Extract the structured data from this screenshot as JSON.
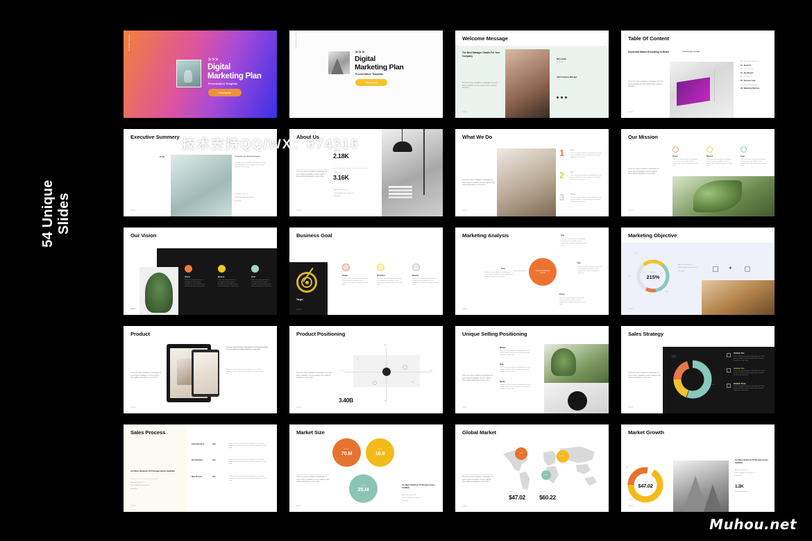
{
  "page": {
    "background": "#000000",
    "side_label": "54 Unique\nSlides",
    "watermark_center": "技术支持QQ/WX：674316",
    "watermark_corner": "Muhou.net"
  },
  "common": {
    "lede": "Good Idea Makes\nEverything Is\nBetter",
    "paragraph": "There are many variations of passages of Lorem Ipsum available, but the majority have suffered alteration in some form.",
    "page_number": "2049",
    "bullets_heading": "Are Many Variations Of Passages Ipsum Available.",
    "bullets": [
      "Approach Format  -  01",
      "Simon Slightly Reasonable 17",
      "Everyright"
    ]
  },
  "slides": [
    {
      "id": "s1",
      "title": "",
      "kind": "hero-gradient",
      "side_text": "Presentation Template",
      "chevron": ">>>",
      "heading_line1": "Digital",
      "heading_line2": "Marketing Plan",
      "subtitle": "Presentation Template",
      "button": "Powerpoint",
      "colors": {
        "gradient_from": "#f0813a",
        "gradient_mid": "#a94bd6",
        "gradient_to": "#3b30e8",
        "button": "#f0913c"
      }
    },
    {
      "id": "s2",
      "title": "",
      "kind": "hero-white",
      "side_text": "Marketing Agency Slide",
      "chevron": ">>>",
      "heading_line1": "Digital",
      "heading_line2": "Marketing Plan",
      "subtitle": "Presentation Template",
      "button": "Powerpoint",
      "colors": {
        "button": "#f6c32a"
      }
    },
    {
      "id": "s3",
      "title": "Welcome Message",
      "kind": "welcome",
      "bg": "#eaf3ed",
      "lede": "The Best Manager Details For Your Company",
      "paragraph": "There are many variations of passages of Lorem Ipsum available, but the majority have suffered alteration.",
      "person_name": "Mary Smith",
      "person_role": "Marketing",
      "person_company": "CEO Company Manager",
      "social": [
        "f",
        "t",
        "in"
      ],
      "page_number": "2049"
    },
    {
      "id": "s4",
      "title": "Table Of Content",
      "kind": "toc",
      "lede": "Good Idea Makes\nEverything Is\nBetter",
      "paragraph": "There are many variations of passages of Lorem Ipsum available but the majority have suffered alteration.",
      "content_label": "Content Details Size Slide",
      "items": [
        {
          "num": "01",
          "label": "Executive Summery",
          "bold": false
        },
        {
          "num": "02",
          "label": "About Us",
          "bold": true
        },
        {
          "num": "03",
          "label": "What We Do",
          "bold": false
        },
        {
          "num": "04",
          "label": "Our Mission",
          "bold": true
        },
        {
          "num": "05",
          "label": "Our Vision",
          "bold": false
        },
        {
          "num": "06",
          "label": "Business Goal",
          "bold": true
        },
        {
          "num": "07",
          "label": "Marketing Analysis",
          "bold": false
        },
        {
          "num": "08",
          "label": "Marketing Objective",
          "bold": true
        }
      ],
      "page_number": "2049"
    },
    {
      "id": "s5",
      "title": "Executive Summery",
      "kind": "exec",
      "plan_label": "PLAN",
      "right_heading": "Getting Plan The Real Time Generator",
      "list": [
        "Executive Format - 01",
        "Simply Slightly Reasonable 17",
        "Everyright"
      ],
      "page_number": "2049"
    },
    {
      "id": "s6",
      "title": "About Us",
      "kind": "about",
      "stat1_label": "Quantity",
      "stat1_value": "2.18K",
      "stat2_label": "Total",
      "stat2_value": "3.16K",
      "list": [
        "Approach Format - 01",
        "Simon Slightly Reasonable 17",
        "Everyright"
      ],
      "page_number": "2049"
    },
    {
      "id": "s7",
      "title": "What We Do",
      "kind": "whatwedo",
      "steps": [
        {
          "num": "1",
          "label": "One",
          "color": "#e8764a"
        },
        {
          "num": "2",
          "label": "Two",
          "color": "#d5d94a"
        },
        {
          "num": "3",
          "label": "Three",
          "color": "#cfcfcf"
        }
      ],
      "page_number": "2049"
    },
    {
      "id": "s8",
      "title": "Our Mission",
      "kind": "mission",
      "cards": [
        {
          "label": "Vision",
          "color": "#e8764a"
        },
        {
          "label": "Mission",
          "color": "#f2c230"
        },
        {
          "label": "Goal",
          "color": "#89c9bd"
        }
      ],
      "page_number": "2049"
    },
    {
      "id": "s9",
      "title": "Our Vision",
      "kind": "vision",
      "cards": [
        {
          "label": "Vision",
          "color": "#ee7a3c"
        },
        {
          "label": "Mission",
          "color": "#f3cb1b"
        },
        {
          "label": "Goal",
          "color": "#9fd9cd"
        }
      ],
      "page_number": "2049"
    },
    {
      "id": "s10",
      "title": "Business Goal",
      "kind": "bizgoal",
      "target_label": "Target",
      "cards": [
        {
          "label": "Target",
          "color": "#e8a38c"
        },
        {
          "label": "Business",
          "color": "#f3e06a"
        },
        {
          "label": "Special",
          "color": "#c8c8c8"
        }
      ],
      "page_number": "2049"
    },
    {
      "id": "s11",
      "title": "Marketing Analysis",
      "kind": "analysis",
      "center_label": "Marketing Business Details",
      "center_color": "#ee7330",
      "nodes": [
        "One",
        "Two",
        "Three",
        "Four"
      ],
      "page_number": "2049"
    },
    {
      "id": "s12",
      "title": "Marketing Objective",
      "kind": "objective",
      "bg": "#eef1fa",
      "donut_label": "Objective",
      "donut_value": "215%",
      "donut_colors": [
        "#f2c230",
        "#e8764a",
        "#89c9bd",
        "#e4e4e4"
      ],
      "tick_labels": [
        "12%",
        "45%",
        "80%"
      ],
      "list": [
        "Approach Format - 01",
        "Simon Slightly Reasonable 17",
        "Everyright"
      ],
      "icons": [
        "bank-icon",
        "rocket-icon",
        "megaphone-icon"
      ],
      "page_number": "2049"
    },
    {
      "id": "s13",
      "title": "Product",
      "kind": "product",
      "right_heading": "There are many variations of passages of Lorem Ipsum available, but the majority have suffered alteration in some form.",
      "page_number": "2049"
    },
    {
      "id": "s14",
      "title": "Product Positioning",
      "kind": "positioning",
      "axis_top": "High",
      "axis_bottom": "Low",
      "axis_left": "Low",
      "axis_right": "High",
      "stat_label": "Business",
      "stat_value": "3.40B",
      "page_number": "2049"
    },
    {
      "id": "s15",
      "title": "Unique Selling Positioning",
      "kind": "usp",
      "rows": [
        {
          "label": "Market",
          "value": "01"
        },
        {
          "label": "Risk",
          "value": "02"
        },
        {
          "label": "Needs",
          "value": "03"
        }
      ],
      "page_number": "2049"
    },
    {
      "id": "s16",
      "title": "Sales Strategy",
      "kind": "strategy",
      "donut_colors": [
        "#89c9bd",
        "#f2c230",
        "#e8764a"
      ],
      "donut_values": [
        55,
        25,
        20
      ],
      "tick_labels": [
        "20%",
        "45%"
      ],
      "items": [
        {
          "label": "Solution One",
          "color": "#ffffff"
        },
        {
          "label": "Solution Two",
          "color": "#f2c230"
        },
        {
          "label": "Solution Three",
          "color": "#ffffff"
        }
      ],
      "page_number": "2049"
    },
    {
      "id": "s17",
      "title": "Sales Process",
      "kind": "process",
      "bg": "#fbfbf1",
      "rows": [
        {
          "label": "Team Research",
          "value": "One"
        },
        {
          "label": "Key Elements",
          "value": "Two"
        },
        {
          "label": "New Process",
          "value": "Two"
        }
      ],
      "page_number": "2049"
    },
    {
      "id": "s18",
      "title": "Market Size",
      "kind": "marketsize",
      "bubbles": [
        {
          "label": "Market",
          "value": "70.M",
          "color": "#e8732f"
        },
        {
          "label": "Sales",
          "value": "10.8",
          "color": "#f3bb1a"
        },
        {
          "label": "Growth",
          "value": "25.M",
          "color": "#8cc4b3"
        }
      ],
      "page_number": "2049"
    },
    {
      "id": "s19",
      "title": "Global Market",
      "kind": "global",
      "markers": [
        {
          "label": "Sales",
          "color": "#e8732f"
        },
        {
          "label": "Market",
          "color": "#f3bb1a"
        },
        {
          "label": "Africa",
          "color": "#8cc4b3"
        }
      ],
      "stats": [
        {
          "label": "Market",
          "value": "$47.02"
        },
        {
          "label": "Revenue",
          "value": "$60.22"
        }
      ],
      "page_number": "2049"
    },
    {
      "id": "s20",
      "title": "Market Growth",
      "kind": "growth",
      "donut_label": "Growth",
      "donut_value": "$47.02",
      "donut_colors": [
        "#f3bb1a",
        "#e8732f"
      ],
      "tick_labels": [
        "20%",
        "45%"
      ],
      "right_heading": "Are Many Variations Of Passages Ipsum Available.",
      "side_value": "1.2K",
      "page_number": "2049"
    }
  ]
}
